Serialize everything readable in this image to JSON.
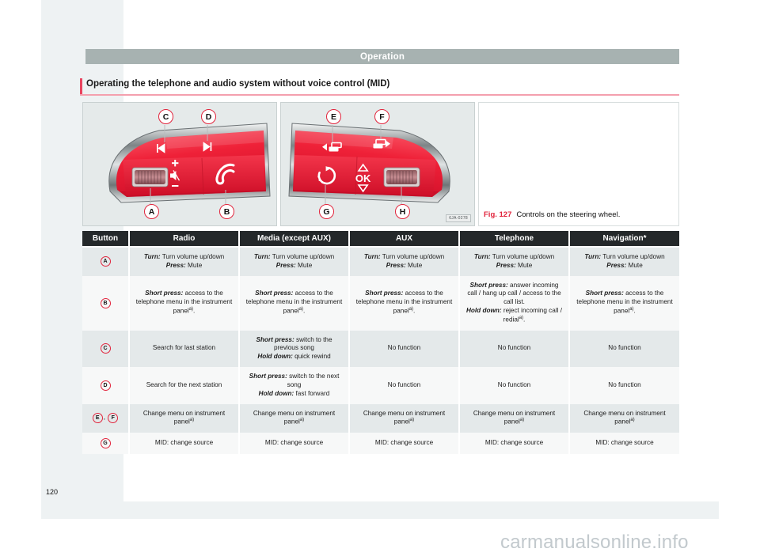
{
  "running_header": {
    "title": "Operation"
  },
  "section": {
    "title": "Operating the telephone and audio system without voice control (MID)"
  },
  "figure": {
    "number": "Fig. 127",
    "caption": "Controls on the steering wheel.",
    "image_code": "6JA-0278",
    "left_panel": {
      "name": "left-steering-wheel-controls",
      "callouts": [
        "C",
        "D",
        "A",
        "B"
      ],
      "icons": [
        "previous-track-icon",
        "next-track-icon",
        "volume-thumbwheel",
        "plus-icon",
        "minus-icon",
        "mute-icon",
        "phone-icon"
      ]
    },
    "right_panel": {
      "name": "right-steering-wheel-controls",
      "callouts": [
        "E",
        "F",
        "G",
        "H"
      ],
      "icons": [
        "menu-left-icon",
        "menu-right-icon",
        "voice-control-icon",
        "up-arrow-icon",
        "ok-label",
        "down-arrow-icon",
        "right-thumbwheel"
      ]
    }
  },
  "table": {
    "headers": [
      "Button",
      "Radio",
      "Media (except AUX)",
      "AUX",
      "Telephone",
      "Navigation*"
    ],
    "rows": [
      {
        "button_labels": [
          "A"
        ],
        "cells": [
          {
            "lines": [
              {
                "lead": "Turn:",
                "text": " Turn volume up/down"
              },
              {
                "lead": "Press:",
                "text": " Mute"
              }
            ]
          },
          {
            "lines": [
              {
                "lead": "Turn:",
                "text": " Turn volume up/down"
              },
              {
                "lead": "Press:",
                "text": " Mute"
              }
            ]
          },
          {
            "lines": [
              {
                "lead": "Turn:",
                "text": " Turn volume up/down"
              },
              {
                "lead": "Press:",
                "text": " Mute"
              }
            ]
          },
          {
            "lines": [
              {
                "lead": "Turn:",
                "text": " Turn volume up/down"
              },
              {
                "lead": "Press:",
                "text": " Mute"
              }
            ]
          },
          {
            "lines": [
              {
                "lead": "Turn:",
                "text": " Turn volume up/down"
              },
              {
                "lead": "Press:",
                "text": " Mute"
              }
            ]
          }
        ]
      },
      {
        "button_labels": [
          "B"
        ],
        "cells": [
          {
            "lines": [
              {
                "lead": "Short press:",
                "text": " access to the telephone menu in the instrument panel",
                "note": "a)",
                "tail": "."
              }
            ]
          },
          {
            "lines": [
              {
                "lead": "Short press:",
                "text": " access to the telephone menu in the instrument panel",
                "note": "a)",
                "tail": "."
              }
            ]
          },
          {
            "lines": [
              {
                "lead": "Short press:",
                "text": " access to the telephone menu in the instrument panel",
                "note": "a)",
                "tail": "."
              }
            ]
          },
          {
            "lines": [
              {
                "lead": "Short press:",
                "text": " answer incoming call / hang up call / access to the call list."
              },
              {
                "lead": "Hold down:",
                "text": " reject incoming call / redial",
                "note": "a)",
                "tail": "."
              }
            ]
          },
          {
            "lines": [
              {
                "lead": "Short press:",
                "text": " access to the telephone menu in the instrument panel",
                "note": "a)",
                "tail": "."
              }
            ]
          }
        ]
      },
      {
        "button_labels": [
          "C"
        ],
        "cells": [
          {
            "lines": [
              {
                "lead": "",
                "text": "Search for last station"
              }
            ]
          },
          {
            "lines": [
              {
                "lead": "Short press:",
                "text": " switch to the previous song"
              },
              {
                "lead": "Hold down:",
                "text": " quick rewind"
              }
            ]
          },
          {
            "lines": [
              {
                "lead": "",
                "text": "No function"
              }
            ]
          },
          {
            "lines": [
              {
                "lead": "",
                "text": "No function"
              }
            ]
          },
          {
            "lines": [
              {
                "lead": "",
                "text": "No function"
              }
            ]
          }
        ]
      },
      {
        "button_labels": [
          "D"
        ],
        "cells": [
          {
            "lines": [
              {
                "lead": "",
                "text": "Search for the next station"
              }
            ]
          },
          {
            "lines": [
              {
                "lead": "Short press:",
                "text": " switch to the next song"
              },
              {
                "lead": "Hold down:",
                "text": " fast forward"
              }
            ]
          },
          {
            "lines": [
              {
                "lead": "",
                "text": "No function"
              }
            ]
          },
          {
            "lines": [
              {
                "lead": "",
                "text": "No function"
              }
            ]
          },
          {
            "lines": [
              {
                "lead": "",
                "text": "No function"
              }
            ]
          }
        ]
      },
      {
        "button_labels": [
          "E",
          "F"
        ],
        "cells": [
          {
            "lines": [
              {
                "lead": "",
                "text": "Change menu on instrument panel",
                "note": "a)"
              }
            ]
          },
          {
            "lines": [
              {
                "lead": "",
                "text": "Change menu on instrument panel",
                "note": "a)"
              }
            ]
          },
          {
            "lines": [
              {
                "lead": "",
                "text": "Change menu on instrument panel",
                "note": "a)"
              }
            ]
          },
          {
            "lines": [
              {
                "lead": "",
                "text": "Change menu on instrument panel",
                "note": "a)"
              }
            ]
          },
          {
            "lines": [
              {
                "lead": "",
                "text": "Change menu on instrument panel",
                "note": "a)"
              }
            ]
          }
        ]
      },
      {
        "button_labels": [
          "G"
        ],
        "cells": [
          {
            "lines": [
              {
                "lead": "",
                "text": "MID: change source"
              }
            ]
          },
          {
            "lines": [
              {
                "lead": "",
                "text": "MID: change source"
              }
            ]
          },
          {
            "lines": [
              {
                "lead": "",
                "text": "MID: change source"
              }
            ]
          },
          {
            "lines": [
              {
                "lead": "",
                "text": "MID: change source"
              }
            ]
          },
          {
            "lines": [
              {
                "lead": "",
                "text": "MID: change source"
              }
            ]
          }
        ]
      }
    ]
  },
  "page_number": "120",
  "watermark": "carmanualsonline.info",
  "colors": {
    "accent_red": "#e1243c",
    "header_gray": "#a7b2b1",
    "table_header": "#24282a",
    "row_shade": "#e4e9ea",
    "row_plain": "#f7f8f8",
    "figure_bg": "#e5eaea"
  }
}
